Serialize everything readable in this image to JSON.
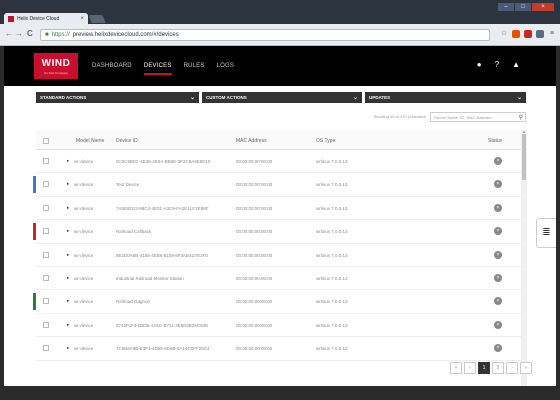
{
  "browser": {
    "tab_title": "Helix Device Cloud",
    "tab_close": "×",
    "url_https": "https://",
    "url_rest": "preview.helixdevicecloud.com/#/devices",
    "nav_back": "←",
    "nav_forward": "→",
    "nav_reload": "C",
    "nav_home": "⌂",
    "ext_star": "☆",
    "ext_menu": "≡",
    "win_min": "–",
    "win_max": "□",
    "win_close": "×"
  },
  "header": {
    "logo_main": "WIND",
    "logo_sub": "An Intel Company",
    "nav": [
      "DASHBOARD",
      "DEVICES",
      "RULES",
      "LOGS"
    ],
    "active_nav": "DEVICES",
    "icon_user": "●",
    "icon_help": "?",
    "icon_bell": "▲"
  },
  "actions": {
    "standard": "STANDARD ACTIONS",
    "custom": "CUSTOM ACTIONS",
    "updates": "UPDATES",
    "chevron": "⌄"
  },
  "search": {
    "showing": "Showing 10 of 470 (Selected)",
    "placeholder": "Device Name, ID, MAC Address..."
  },
  "table": {
    "headers": [
      "Model Name",
      "Device ID",
      "MAC Address",
      "OS Type",
      "Status"
    ],
    "rows": [
      {
        "model": "wr-device",
        "id": "0C0C6B0C-4E48-4E5A-BB6E-3F2C8A9E9D10",
        "mac": "00:00:00:00:00:00",
        "os": "wrlinux 7.0.0.13",
        "accent": ""
      },
      {
        "model": "wr-device",
        "id": "Test Device",
        "mac": "00:00:00:00:00:00",
        "os": "wrlinux 7.0.0.13",
        "accent": "#3a7cc8"
      },
      {
        "model": "wr-device",
        "id": "7A5E8D12-98C4-4E01-A3C9-FA2E11C7E88F",
        "mac": "00:00:00:00:00:00",
        "os": "wrlinux 7.0.0.13",
        "accent": ""
      },
      {
        "model": "wr-device",
        "id": "Railroad Callback",
        "mac": "00:00:00:00:00:00",
        "os": "wrlinux 7.0.0.13",
        "accent": "#c62828"
      },
      {
        "model": "wr-device",
        "id": "9E2D0A6B-4158-4EB6-8109-6F3AB4D7E2F0",
        "mac": "00:00:00:00:00:00",
        "os": "wrlinux 7.0.0.13",
        "accent": ""
      },
      {
        "model": "wr-device",
        "id": "Industrial Railroad Monitor Station",
        "mac": "00:00:00:00:00:00",
        "os": "wrlinux 7.0.0.13",
        "accent": ""
      },
      {
        "model": "wr-device",
        "id": "Railroad Gagnon",
        "mac": "00:00:00:00:00:00",
        "os": "wrlinux 7.0.0.13",
        "accent": "#2e7d32"
      },
      {
        "model": "wr-device",
        "id": "8743F1F4-DB36-4A6C-B711-3E5E5B26C93D",
        "mac": "00:00:00:00:00:00",
        "os": "wrlinux 7.0.0.13",
        "accent": ""
      },
      {
        "model": "wr-device",
        "id": "7C5B6A9B-E3F1-4D68-8D6B-9A14C0FF25C4",
        "mac": "00:00:00:00:00:00",
        "os": "wrlinux 7.0.0.13",
        "accent": ""
      }
    ],
    "row_arrow": "▸",
    "status_glyph": "×"
  },
  "sidepanel_icon": "≣",
  "pager": {
    "first": "«",
    "prev": "‹",
    "pages": [
      "1",
      "2"
    ],
    "next": "›",
    "last": "»"
  },
  "colors": {
    "brand": "#c8102e",
    "topbar": "#000000",
    "action_bar": "#333333"
  }
}
